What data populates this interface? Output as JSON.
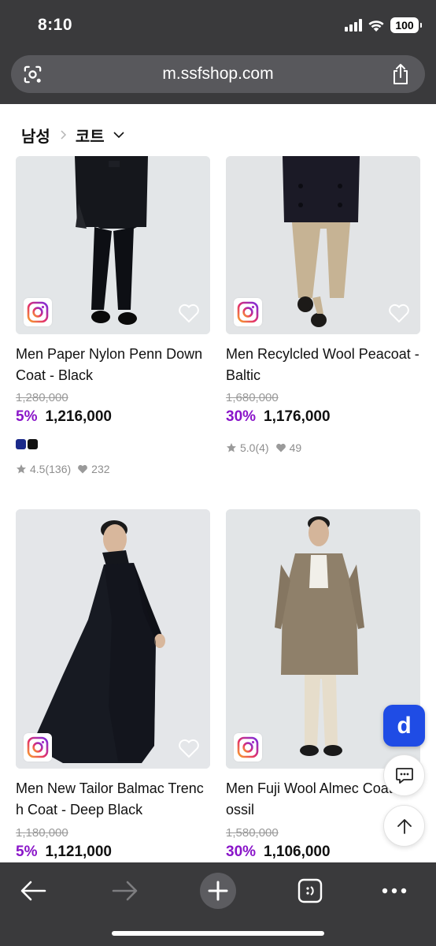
{
  "status_bar": {
    "time": "8:10",
    "battery": "100"
  },
  "browser": {
    "url": "m.ssfshop.com"
  },
  "breadcrumb": {
    "parent": "남성",
    "current": "코트"
  },
  "products": [
    {
      "name": "Men Paper Nylon Penn Down Coat - Black",
      "original_price": "1,280,000",
      "discount": "5%",
      "price": "1,216,000",
      "swatches": [
        "#1b2a8a",
        "#111111"
      ],
      "rating": "4.5(136)",
      "likes": "232"
    },
    {
      "name": "Men Recylcled Wool Peacoat - Baltic",
      "original_price": "1,680,000",
      "discount": "30%",
      "price": "1,176,000",
      "rating": "5.0(4)",
      "likes": "49"
    },
    {
      "name": "Men New Tailor Balmac Trench Coat - Deep Black",
      "original_price": "1,180,000",
      "discount": "5%",
      "price": "1,121,000"
    },
    {
      "name": "Men Fuji Wool Almec Coat - Fossil",
      "original_price": "1,580,000",
      "discount": "30%",
      "price": "1,106,000"
    }
  ],
  "floating": {
    "d_label": "d"
  },
  "colors": {
    "discount": "#8a15c9",
    "float_d_bg": "#1f4ce5",
    "chrome": "#3a3a3c"
  },
  "icons": [
    "lens-icon",
    "share-icon",
    "chevron-right-icon",
    "chevron-down-icon",
    "instagram-icon",
    "heart-outline-icon",
    "star-icon",
    "heart-icon",
    "chat-icon",
    "arrow-up-icon",
    "back-arrow-icon",
    "forward-arrow-icon",
    "plus-icon",
    "tabs-icon",
    "more-icon"
  ]
}
